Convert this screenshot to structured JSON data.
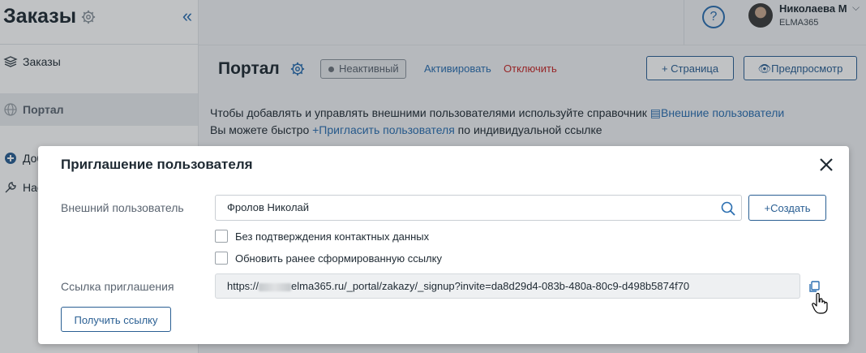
{
  "sidebar": {
    "title": "Заказы",
    "collapse_glyph": "«",
    "items": [
      {
        "label": "Заказы",
        "icon": "layers-icon"
      },
      {
        "label": "Портал",
        "icon": "globe-icon"
      }
    ],
    "add_label": "Доб",
    "settings_label": "Нас"
  },
  "header": {
    "help_glyph": "?",
    "user_name": "Николаева М",
    "org_name": "ELMA365"
  },
  "page": {
    "title": "Портал",
    "status": "Неактивный",
    "activate_label": "Активировать",
    "disable_label": "Отключить",
    "add_page_label": "+ Страница",
    "preview_label": "Предпросмотр",
    "info_line1_prefix": "Чтобы добавлять и управлять внешними пользователями используйте справочник ",
    "info_line1_link": "Внешние пользователи",
    "info_line2_prefix": "Вы можете быстро ",
    "info_line2_link": "+Пригласить пользователя",
    "info_line2_suffix": " по индивидуальной ссылке"
  },
  "modal": {
    "title": "Приглашение пользователя",
    "external_user_label": "Внешний пользователь",
    "external_user_value": "Фролов Николай",
    "create_label": "+Создать",
    "checkbox_no_confirm": "Без подтверждения контактных данных",
    "checkbox_refresh_link": "Обновить ранее сформированную ссылку",
    "invite_link_label": "Ссылка приглашения",
    "invite_link_prefix": "https://",
    "invite_link_value": "elma365.ru/_portal/zakazy/_signup?invite=da8d29d4-083b-480a-80c9-d498b5874f70",
    "get_link_label": "Получить ссылку"
  },
  "colors": {
    "accent": "#2a6eb0",
    "danger": "#c62828",
    "overlay": "rgba(30,36,42,0.28)"
  }
}
